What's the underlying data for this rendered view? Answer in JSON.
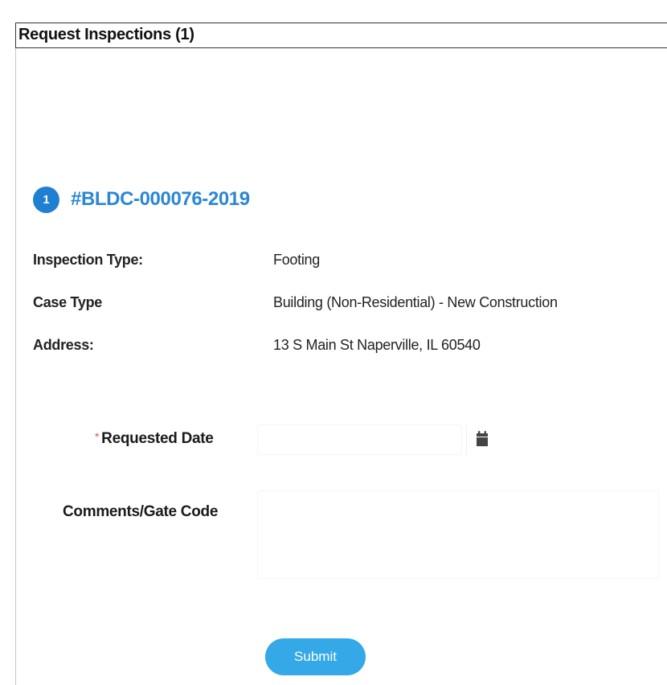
{
  "window": {
    "title": "Request Inspections (1)"
  },
  "case": {
    "step_number": "1",
    "case_id": "#BLDC-000076-2019"
  },
  "details": [
    {
      "label": "Inspection Type:",
      "value": "Footing"
    },
    {
      "label": "Case Type",
      "value": "Building (Non-Residential) - New Construction"
    },
    {
      "label": "Address:",
      "value": "13 S Main St Naperville, IL 60540"
    }
  ],
  "form": {
    "requested_date": {
      "required_mark": "*",
      "label": "Requested Date",
      "value": "",
      "placeholder": ""
    },
    "comments": {
      "label": "Comments/Gate Code",
      "value": "",
      "placeholder": ""
    },
    "submit_label": "Submit"
  },
  "icons": {
    "calendar": "calendar-icon"
  },
  "colors": {
    "accent_blue": "#2b87d4",
    "badge_blue": "#1f7fd0",
    "submit_blue": "#35a8e8",
    "required_red": "#e05050"
  }
}
